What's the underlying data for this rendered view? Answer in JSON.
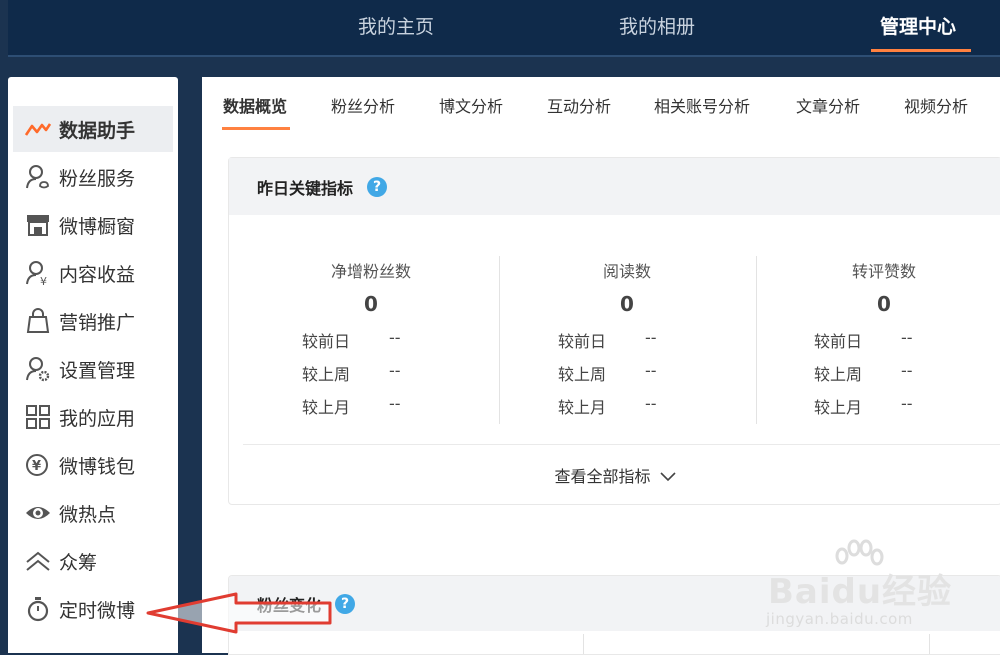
{
  "topnav": {
    "tabs": [
      {
        "label": "我的主页"
      },
      {
        "label": "我的相册"
      },
      {
        "label": "管理中心"
      }
    ],
    "active_tab": "管理中心",
    "accent_color": "#ff8140"
  },
  "sidebar": {
    "items": [
      {
        "label": "数据助手",
        "icon": "trend-line-icon"
      },
      {
        "label": "粉丝服务",
        "icon": "fan-service-icon"
      },
      {
        "label": "微博橱窗",
        "icon": "storefront-icon"
      },
      {
        "label": "内容收益",
        "icon": "user-yuan-icon"
      },
      {
        "label": "营销推广",
        "icon": "shopping-bag-icon"
      },
      {
        "label": "设置管理",
        "icon": "user-gear-icon"
      },
      {
        "label": "我的应用",
        "icon": "app-grid-icon"
      },
      {
        "label": "微博钱包",
        "icon": "wallet-yuan-icon"
      },
      {
        "label": "微热点",
        "icon": "eye-icon"
      },
      {
        "label": "众筹",
        "icon": "double-chevron-up-icon"
      },
      {
        "label": "定时微博",
        "icon": "stopwatch-icon"
      }
    ],
    "active_item": "数据助手"
  },
  "subtabs": [
    {
      "label": "数据概览"
    },
    {
      "label": "粉丝分析"
    },
    {
      "label": "博文分析"
    },
    {
      "label": "互动分析"
    },
    {
      "label": "相关账号分析"
    },
    {
      "label": "文章分析"
    },
    {
      "label": "视频分析"
    }
  ],
  "key_metrics": {
    "title": "昨日关键指标",
    "help": "?",
    "metrics": [
      {
        "name": "净增粉丝数",
        "value": "0",
        "rows": [
          {
            "label": "较前日",
            "value": "--"
          },
          {
            "label": "较上周",
            "value": "--"
          },
          {
            "label": "较上月",
            "value": "--"
          }
        ]
      },
      {
        "name": "阅读数",
        "value": "0",
        "rows": [
          {
            "label": "较前日",
            "value": "--"
          },
          {
            "label": "较上周",
            "value": "--"
          },
          {
            "label": "较上月",
            "value": "--"
          }
        ]
      },
      {
        "name": "转评赞数",
        "value": "0",
        "rows": [
          {
            "label": "较前日",
            "value": "--"
          },
          {
            "label": "较上周",
            "value": "--"
          },
          {
            "label": "较上月",
            "value": "--"
          }
        ]
      }
    ],
    "view_all": "查看全部指标"
  },
  "fans_change": {
    "title": "粉丝变化",
    "help": "?"
  },
  "watermark": {
    "logo": "Baidu经验",
    "url": "jingyan.baidu.com"
  },
  "annotation_color": "#e03c31"
}
